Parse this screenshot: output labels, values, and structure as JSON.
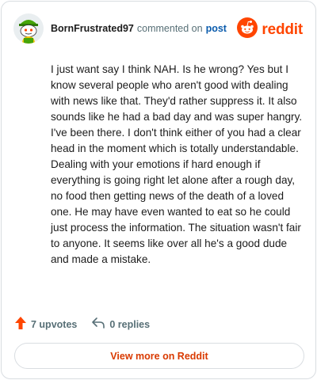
{
  "comment": {
    "username": "BornFrustrated97",
    "commented_on_text": "commented on",
    "post_link": "post",
    "avatar_icon": "snoo-avatar-icon",
    "body": "I just want say I think NAH. Is he wrong? Yes but I know several people who aren't good with dealing with news like that. They'd rather suppress it. It also sounds like he had a bad day and was super hangry. I've been there. I don't think either of you had a clear head in the moment which is totally understandable. Dealing with your emotions if hard enough if everything is going right let alone after a rough day, no food then getting news of the death of a loved one. He may have even wanted to eat so he could just process the information. The situation wasn't fair to anyone. It seems like over all he's a good dude and made a mistake."
  },
  "brand": {
    "wordmark": "reddit",
    "logo_icon": "reddit-logo-icon",
    "color": "#ff4500"
  },
  "actions": {
    "upvotes": "7 upvotes",
    "upvote_icon": "upvote-arrow-icon",
    "upvote_color": "#ff4500",
    "replies": "0 replies",
    "reply_icon": "reply-arrow-icon"
  },
  "footer": {
    "view_more_label": "View more on Reddit",
    "accent": "#d93a00"
  }
}
